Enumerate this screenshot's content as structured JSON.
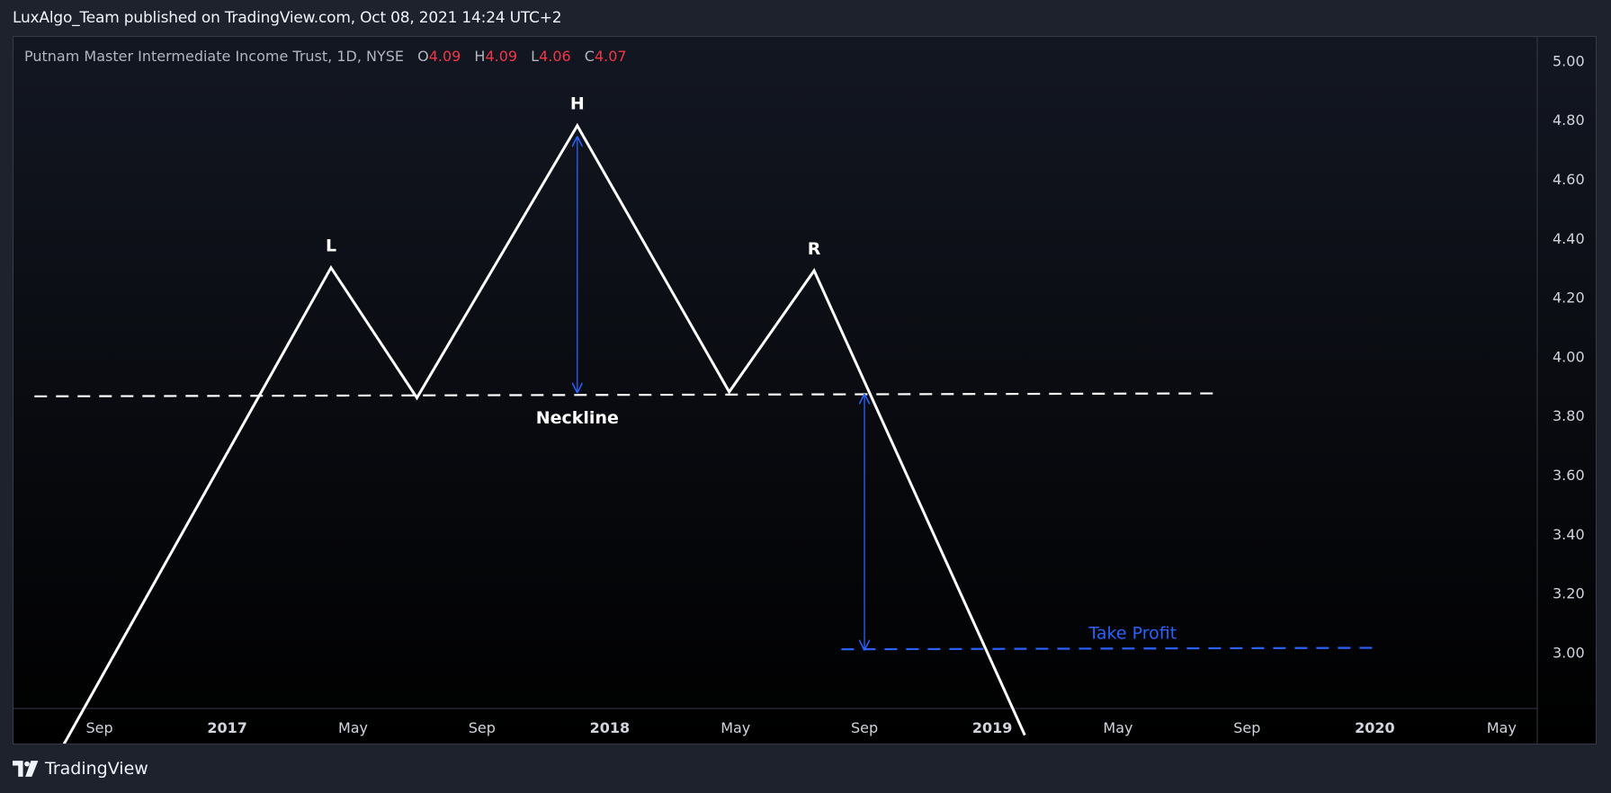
{
  "header": {
    "published": "LuxAlgo_Team published on TradingView.com, Oct 08, 2021 14:24 UTC+2"
  },
  "legend": {
    "symbol_desc": "Putnam Master Intermediate Income Trust, 1D, NYSE",
    "o_label": "O",
    "o_value": "4.09",
    "h_label": "H",
    "h_value": "4.09",
    "l_label": "L",
    "l_value": "4.06",
    "c_label": "C",
    "c_value": "4.07",
    "value_color": "#f23645"
  },
  "footer": {
    "brand": "TradingView",
    "logo_icon": "tradingview-logo-icon"
  },
  "colors": {
    "background_top": "#131722",
    "background_bottom": "#000000",
    "line": "#ffffff",
    "annotation_blue": "#2962ff",
    "axis_text": "#d1d4dc"
  },
  "chart_data": {
    "type": "line",
    "x": [
      "2016-07-15",
      "2017-04-10",
      "2017-07-01",
      "2017-12-01",
      "2018-04-25",
      "2018-07-15",
      "2019-02-01"
    ],
    "values": [
      2.6,
      4.3,
      3.86,
      4.78,
      3.88,
      4.29,
      2.72
    ],
    "ylim": [
      2.81,
      5.08
    ],
    "xlim": [
      "2016-06-11",
      "2020-06-04"
    ],
    "y_ticks": [
      "5.00",
      "4.80",
      "4.60",
      "4.40",
      "4.20",
      "4.00",
      "3.80",
      "3.60",
      "3.40",
      "3.20",
      "3.00"
    ],
    "y_tick_values": [
      5.0,
      4.8,
      4.6,
      4.4,
      4.2,
      4.0,
      3.8,
      3.6,
      3.4,
      3.2,
      3.0
    ],
    "x_ticks": [
      {
        "date": "2016-09-01",
        "label": "Sep",
        "major": false
      },
      {
        "date": "2017-01-01",
        "label": "2017",
        "major": true
      },
      {
        "date": "2017-05-01",
        "label": "May",
        "major": false
      },
      {
        "date": "2017-09-01",
        "label": "Sep",
        "major": false
      },
      {
        "date": "2018-01-01",
        "label": "2018",
        "major": true
      },
      {
        "date": "2018-05-01",
        "label": "May",
        "major": false
      },
      {
        "date": "2018-09-01",
        "label": "Sep",
        "major": false
      },
      {
        "date": "2019-01-01",
        "label": "2019",
        "major": true
      },
      {
        "date": "2019-05-01",
        "label": "May",
        "major": false
      },
      {
        "date": "2019-09-01",
        "label": "Sep",
        "major": false
      },
      {
        "date": "2020-01-01",
        "label": "2020",
        "major": true
      },
      {
        "date": "2020-05-01",
        "label": "May",
        "major": false
      }
    ],
    "grid": false,
    "annotations": {
      "peak_labels": [
        {
          "text": "L",
          "x": "2017-04-10",
          "y": 4.3
        },
        {
          "text": "H",
          "x": "2017-12-01",
          "y": 4.78
        },
        {
          "text": "R",
          "x": "2018-07-15",
          "y": 4.29
        }
      ],
      "neckline": {
        "label": "Neckline",
        "label_x": "2017-12-01",
        "from": {
          "x": "2016-07-01",
          "y": 3.865
        },
        "to": {
          "x": "2019-08-01",
          "y": 3.875
        }
      },
      "take_profit": {
        "label": "Take Profit",
        "label_x": "2019-05-15",
        "from": {
          "x": "2018-08-10",
          "y": 3.01
        },
        "to": {
          "x": "2020-01-01",
          "y": 3.015
        }
      },
      "measure_arrows": [
        {
          "x": "2017-12-01",
          "from": 3.88,
          "to": 4.74
        },
        {
          "x": "2018-09-01",
          "from": 3.01,
          "to": 3.87
        }
      ]
    }
  }
}
